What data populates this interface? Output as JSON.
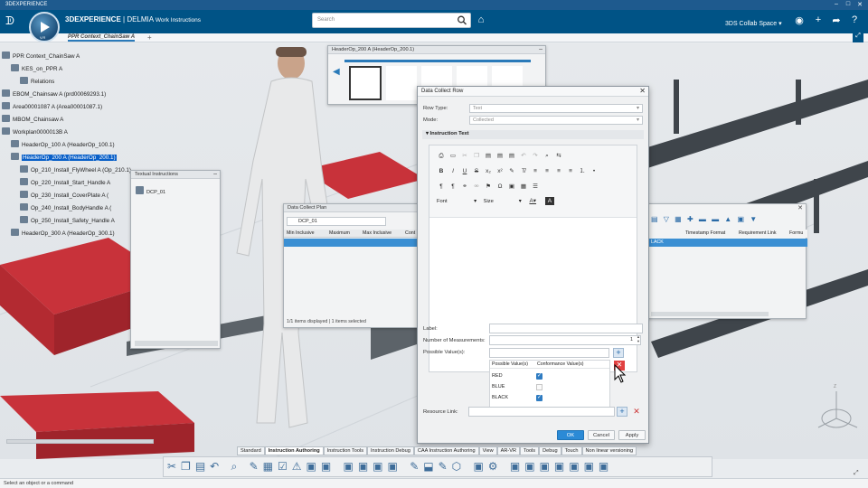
{
  "window": {
    "title": "3DEXPERIENCE"
  },
  "topbar": {
    "brand_bold": "3DEXPERIENCE",
    "brand_rest": " | DELMIA",
    "app_name": "Work Instructions",
    "compass_version": "V.R",
    "search_placeholder": "Search",
    "collab_space": "3DS Collab Space ▾"
  },
  "tab": {
    "title": "PPR Context_ChainSaw A",
    "add": "+"
  },
  "tree": {
    "items": [
      {
        "label": "PPR Context_ChainSaw A",
        "selected": false
      },
      {
        "label": "KES_on_PPR A",
        "selected": false
      },
      {
        "label": "Relations",
        "selected": false
      },
      {
        "label": "EBOM_Chainsaw A (prd00069293.1)",
        "selected": false
      },
      {
        "label": "Area00001087 A (Area00001087.1)",
        "selected": false
      },
      {
        "label": "MBOM_Chainsaw A",
        "selected": false
      },
      {
        "label": "Workplan0000013B A",
        "selected": false
      },
      {
        "label": "HeaderOp_100 A (HeaderOp_100.1)",
        "selected": false
      },
      {
        "label": "HeaderOp_200 A (HeaderOp_200.1)",
        "selected": true
      },
      {
        "label": "Op_210_Install_FlyWheel A (Op_210.1)",
        "selected": false
      },
      {
        "label": "Op_220_Install_Start_Handle A",
        "selected": false
      },
      {
        "label": "Op_230_Install_CoverPlate A (",
        "selected": false
      },
      {
        "label": "Op_240_Install_BodyHandle A (",
        "selected": false
      },
      {
        "label": "Op_250_Install_Safety_Handle A",
        "selected": false
      },
      {
        "label": "HeaderOp_300 A (HeaderOp_300.1)",
        "selected": false
      }
    ]
  },
  "header_panel": {
    "title": "HeaderOp_200 A (HeaderOp_200.1)"
  },
  "textual_panel": {
    "title": "Textual Instructions",
    "item": "DCP_01"
  },
  "dcp_panel": {
    "title": "Data Collect Plan",
    "field": "DCP_01",
    "columns": [
      "Min Inclusive",
      "Maximum",
      "Max Inclusive",
      "Cont"
    ],
    "status": "1/1 items displayed | 1 items selected"
  },
  "right_table": {
    "columns": [
      "Timestamp Format",
      "Requirement Link",
      "Formu"
    ],
    "row_cell": "LACK"
  },
  "dialog": {
    "title": "Data Collect Row",
    "row_type_label": "Row Type:",
    "row_type_value": "Text",
    "mode_label": "Mode:",
    "mode_value": "Collected",
    "section": "Instruction Text",
    "font_label": "Font",
    "size_label": "Size",
    "label_label": "Label:",
    "num_label": "Number of Measurements:",
    "num_value": "1",
    "possible_label": "Possible Value(s):",
    "col_possible": "Possible Value(s)",
    "col_conformance": "Conformance Value(s)",
    "values": [
      {
        "value": "RED",
        "conformance": true
      },
      {
        "value": "BLUE",
        "conformance": false
      },
      {
        "value": "BLACK",
        "conformance": true
      }
    ],
    "resource_label": "Resource Link:",
    "ok": "OK",
    "cancel": "Cancel",
    "apply": "Apply"
  },
  "bottom_tabs": [
    "Standard",
    "Instruction Authoring",
    "Instruction Tools",
    "Instruction Debug",
    "CAA Instruction Authoring",
    "View",
    "AR-VR",
    "Tools",
    "Debug",
    "Touch",
    "Non linear versioning"
  ],
  "status_text": "Select an object or a command",
  "colors": {
    "accent": "#005386",
    "selection": "#0a60c8",
    "ok_button": "#2b8ad6"
  }
}
